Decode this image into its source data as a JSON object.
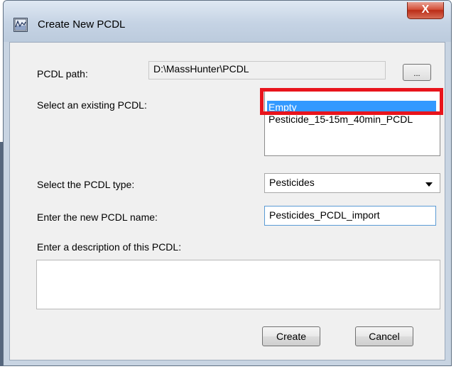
{
  "window": {
    "title": "Create New PCDL",
    "close_label": "X"
  },
  "path": {
    "label": "PCDL path:",
    "value": "D:\\MassHunter\\PCDL",
    "browse_label": "..."
  },
  "existing": {
    "label": "Select an existing PCDL:",
    "items": [
      {
        "label": "Empty",
        "selected": true
      },
      {
        "label": "Pesticide_15-15m_40min_PCDL",
        "selected": false
      }
    ]
  },
  "type": {
    "label": "Select the PCDL type:",
    "value": "Pesticides"
  },
  "name": {
    "label": "Enter the new PCDL name:",
    "value": "Pesticides_PCDL_import"
  },
  "description": {
    "label": "Enter a description of this PCDL:",
    "value": ""
  },
  "buttons": {
    "create": "Create",
    "cancel": "Cancel"
  }
}
